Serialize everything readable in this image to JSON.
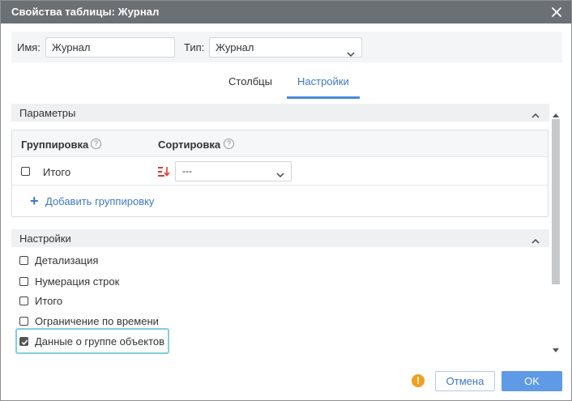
{
  "dialog": {
    "title": "Свойства таблицы: Журнал"
  },
  "properties": {
    "name_label": "Имя:",
    "name_value": "Журнал",
    "type_label": "Тип:",
    "type_value": "Журнал"
  },
  "tabs": [
    {
      "label": "Столбцы",
      "active": false
    },
    {
      "label": "Настройки",
      "active": true
    }
  ],
  "parameters_section": {
    "title": "Параметры",
    "grouping_header": "Группировка",
    "sorting_header": "Сортировка",
    "help_glyph": "?",
    "rows": [
      {
        "label": "Итого",
        "checked": false,
        "sort_value": "---"
      }
    ],
    "add_grouping_label": "Добавить группировку",
    "add_glyph": "+"
  },
  "settings_section": {
    "title": "Настройки",
    "options": [
      {
        "label": "Детализация",
        "checked": false
      },
      {
        "label": "Нумерация строк",
        "checked": false
      },
      {
        "label": "Итого",
        "checked": false
      },
      {
        "label": "Ограничение по времени",
        "checked": false
      },
      {
        "label": "Данные о группе объектов",
        "checked": true
      }
    ]
  },
  "footer": {
    "warning_glyph": "!",
    "cancel_label": "Отмена",
    "ok_label": "OK"
  },
  "colors": {
    "titlebar": "#6b7075",
    "accent": "#3d78c7",
    "ok_button": "#5f9ae6",
    "warning": "#f0a020",
    "sort_icon": "#e03b2f",
    "focus_ring": "#7fcfd9"
  },
  "icons": {
    "close": "close-icon",
    "dropdown": "chevron-down-icon",
    "collapse": "chevron-up-icon",
    "help": "help-icon",
    "sort": "sort-descending-icon",
    "add": "plus-icon",
    "warning": "warning-icon"
  }
}
